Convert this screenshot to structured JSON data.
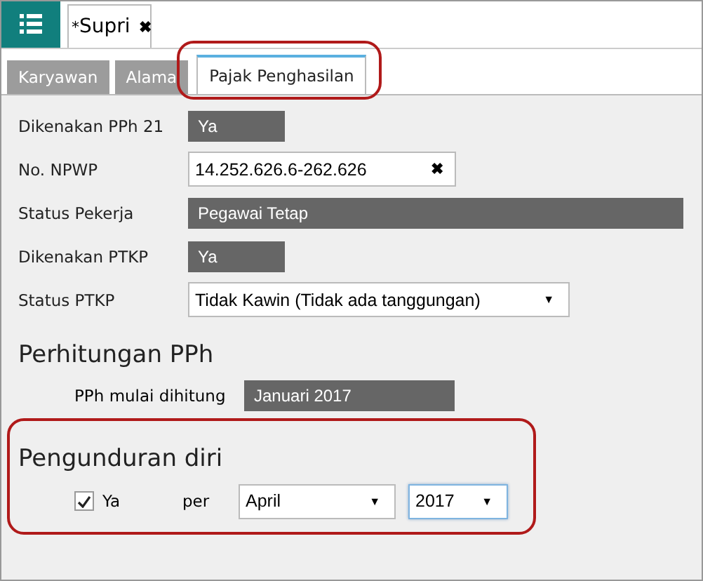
{
  "doc_tabs": [
    {
      "label": "Supri",
      "modified_mark": "*",
      "close": "✖",
      "selected": true
    }
  ],
  "section_tabs": [
    {
      "label": "Karyawan",
      "selected": false
    },
    {
      "label": "Alama",
      "selected": false
    },
    {
      "label": "Pajak Penghasilan",
      "selected": true
    }
  ],
  "fields": [
    {
      "kind": "readonly",
      "label": "Dikenakan PPh 21",
      "value": "Ya",
      "wide": false
    },
    {
      "kind": "input",
      "label": "No. NPWP",
      "value": "14.252.626.6-262.626",
      "clear": "✖"
    },
    {
      "kind": "readonly",
      "label": "Status Pekerja",
      "value": "Pegawai Tetap",
      "wide": true
    },
    {
      "kind": "readonly",
      "label": "Dikenakan PTKP",
      "value": "Ya",
      "wide": false
    },
    {
      "kind": "select",
      "label": "Status PTKP",
      "value": "Tidak Kawin (Tidak ada tanggungan)",
      "caret": "▼"
    }
  ],
  "pph": {
    "heading": "Perhitungan PPh",
    "label": "PPh mulai dihitung",
    "value": "Januari 2017"
  },
  "resign": {
    "heading": "Pengunduran diri",
    "checkbox": {
      "label": "Ya",
      "checked": true
    },
    "per": "per",
    "month": {
      "value": "April",
      "caret": "▼",
      "focused": false
    },
    "year": {
      "value": "2017",
      "caret": "▼",
      "focused": true
    }
  }
}
